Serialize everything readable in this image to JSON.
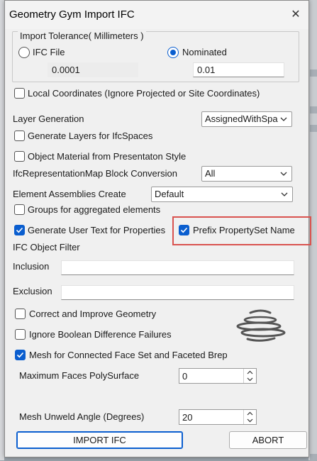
{
  "window": {
    "title": "Geometry Gym Import IFC"
  },
  "tolerance": {
    "legend": "Import Tolerance( Millimeters )",
    "ifc_file_label": "IFC File",
    "ifc_file_value": "0.0001",
    "nominated_label": "Nominated",
    "nominated_value": "0.01",
    "selected": "Nominated"
  },
  "local_coordinates": {
    "label": "Local Coordinates (Ignore Projected or Site Coordinates)",
    "checked": false
  },
  "layer_generation": {
    "label": "Layer Generation",
    "value": "AssignedWithSpa"
  },
  "generate_layers": {
    "label": "Generate Layers for IfcSpaces",
    "checked": false
  },
  "object_material": {
    "label": "Object Material from Presentaton Style",
    "checked": false
  },
  "rep_map": {
    "label": "IfcRepresentationMap Block Conversion",
    "value": "All"
  },
  "element_assemblies": {
    "label": "Element Assemblies Create",
    "value": "Default"
  },
  "groups": {
    "label": "Groups for aggregated elements",
    "checked": false
  },
  "user_text": {
    "label": "Generate User Text for Properties",
    "checked": true
  },
  "prefix_pset": {
    "label": "Prefix PropertySet Name",
    "checked": true
  },
  "filter": {
    "heading": "IFC Object Filter",
    "inclusion_label": "Inclusion",
    "inclusion_value": "",
    "exclusion_label": "Exclusion",
    "exclusion_value": ""
  },
  "correct_geometry": {
    "label": "Correct and Improve Geometry",
    "checked": false
  },
  "ignore_boolean": {
    "label": "Ignore Boolean Difference Failures",
    "checked": false
  },
  "mesh_connected": {
    "label": "Mesh for Connected Face Set and Faceted Brep",
    "checked": true
  },
  "max_faces": {
    "label": "Maximum Faces PolySurface",
    "value": "0"
  },
  "unweld": {
    "label": "Mesh Unweld Angle (Degrees)",
    "value": "20"
  },
  "buttons": {
    "import": "IMPORT IFC",
    "abort": "ABORT"
  },
  "colors": {
    "accent": "#0a5ecf",
    "highlight": "#d9534f"
  },
  "icons": {
    "close": "close-icon",
    "logo": "geometry-gym-logo-icon"
  }
}
